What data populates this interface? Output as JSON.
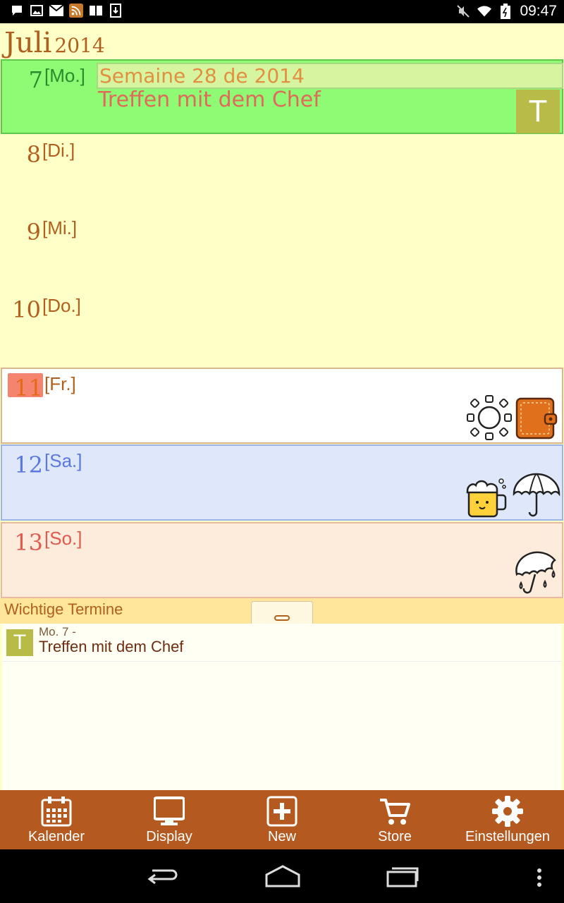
{
  "status": {
    "clock": "09:47"
  },
  "header": {
    "month": "Juli",
    "year": "2014"
  },
  "days": [
    {
      "num": "7",
      "abbr": "[Mo.]",
      "color": "#2b8a2b",
      "bg": "#8ffa74"
    },
    {
      "num": "8",
      "abbr": "[Di.]",
      "color": "#b0601e"
    },
    {
      "num": "9",
      "abbr": "[Mi.]",
      "color": "#b0601e"
    },
    {
      "num": "10",
      "abbr": "[Do.]",
      "color": "#b0601e"
    },
    {
      "num": "11",
      "abbr": "[Fr.]",
      "color": "#e46a1a",
      "bg": "#ffffff"
    },
    {
      "num": "12",
      "abbr": "[Sa.]",
      "color": "#5a78e0",
      "bg": "#dee8fa"
    },
    {
      "num": "13",
      "abbr": "[So.]",
      "color": "#e05a50",
      "bg": "#fdebdb"
    }
  ],
  "week_label": "Semaine 28 de 2014",
  "event": {
    "title": "Treffen mit dem Chef",
    "tag": "T"
  },
  "important": {
    "header": "Wichtige Termine",
    "items": [
      {
        "tag": "T",
        "date": "Mo. 7  -",
        "title": "Treffen mit dem Chef"
      }
    ]
  },
  "toolbar": {
    "items": [
      {
        "label": "Kalender",
        "icon": "calendar-icon"
      },
      {
        "label": "Display",
        "icon": "monitor-icon"
      },
      {
        "label": "New",
        "icon": "plus-icon"
      },
      {
        "label": "Store",
        "icon": "cart-icon"
      },
      {
        "label": "Einstellungen",
        "icon": "gear-icon"
      }
    ]
  },
  "colors": {
    "accent": "#b4591f",
    "today": "#f5846e",
    "tag": "#b9bb48"
  }
}
